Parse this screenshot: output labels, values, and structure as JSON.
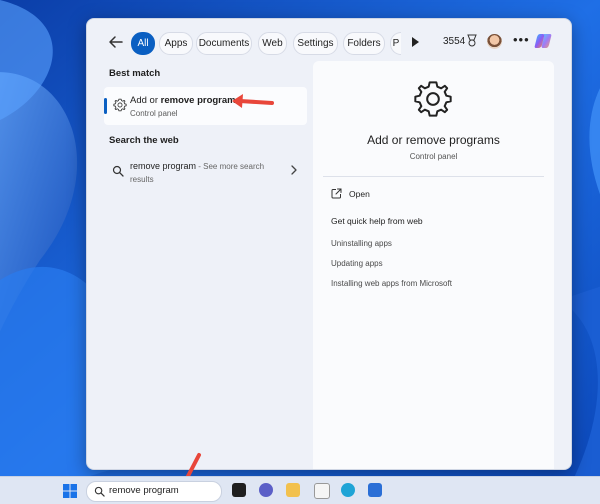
{
  "filters": {
    "tabs": [
      {
        "label": "All",
        "active": true
      },
      {
        "label": "Apps"
      },
      {
        "label": "Documents"
      },
      {
        "label": "Web"
      },
      {
        "label": "Settings"
      },
      {
        "label": "Folders"
      },
      {
        "label": "P"
      }
    ],
    "rewards_points": "3554",
    "more_label": "•••"
  },
  "results": {
    "best_match_heading": "Best match",
    "best_match": {
      "title_prefix": "Add or ",
      "title_bold": "remove programs",
      "subtitle": "Control panel"
    },
    "web_heading": "Search the web",
    "web_item": {
      "query": "remove program",
      "suffix": " - See more search results"
    }
  },
  "detail": {
    "title": "Add or remove programs",
    "subtitle": "Control panel",
    "open_label": "Open",
    "help_title": "Get quick help from web",
    "help_links": [
      "Uninstalling apps",
      "Updating apps",
      "Installing web apps from Microsoft"
    ]
  },
  "taskbar": {
    "search_text": "remove program"
  },
  "colors": {
    "accent": "#0a5fc2",
    "annotation_arrow": "#e8463a"
  }
}
